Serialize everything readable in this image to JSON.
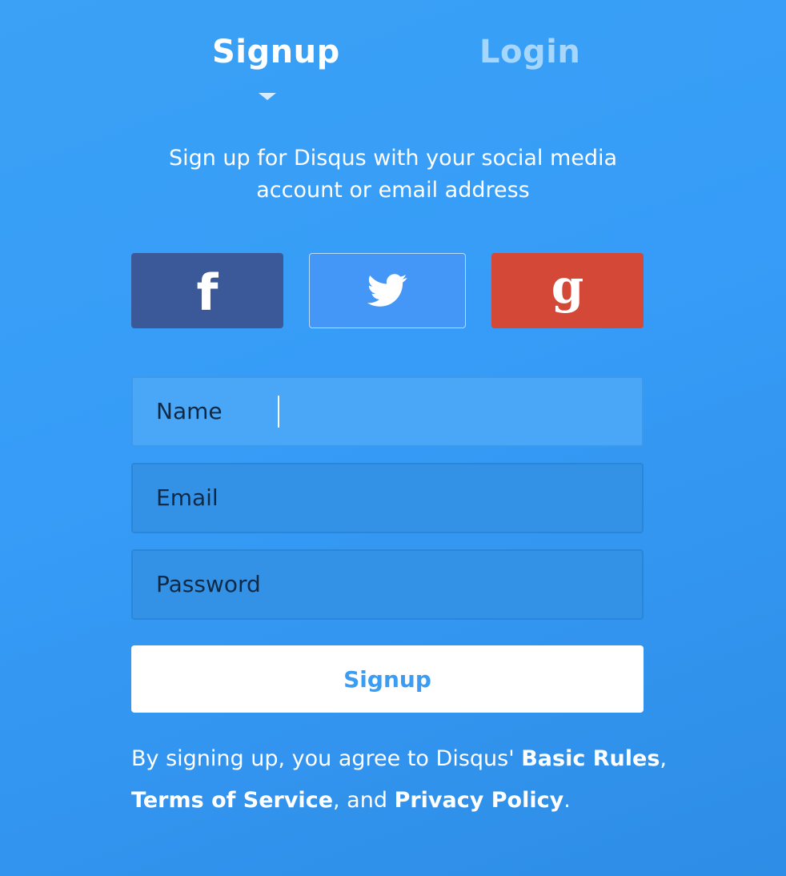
{
  "tabs": {
    "signup": "Signup",
    "login": "Login"
  },
  "intro": {
    "line1": "Sign up for Disqus with your social media",
    "line2": "account or email address"
  },
  "social": {
    "facebook_glyph": "f",
    "google_glyph": "g",
    "colors": {
      "facebook": "#3b5998",
      "twitter": "#4597f7",
      "google": "#d34836"
    }
  },
  "form": {
    "name_label": "Name",
    "name_value": "",
    "email_label": "Email",
    "email_value": "",
    "password_label": "Password",
    "password_value": "",
    "submit_label": "Signup"
  },
  "legal": {
    "prefix": "By signing up, you agree to Disqus' ",
    "basic_rules": "Basic Rules",
    "sep1": ",",
    "terms": "Terms of Service",
    "sep2": ", and ",
    "privacy": "Privacy Policy",
    "end": "."
  }
}
